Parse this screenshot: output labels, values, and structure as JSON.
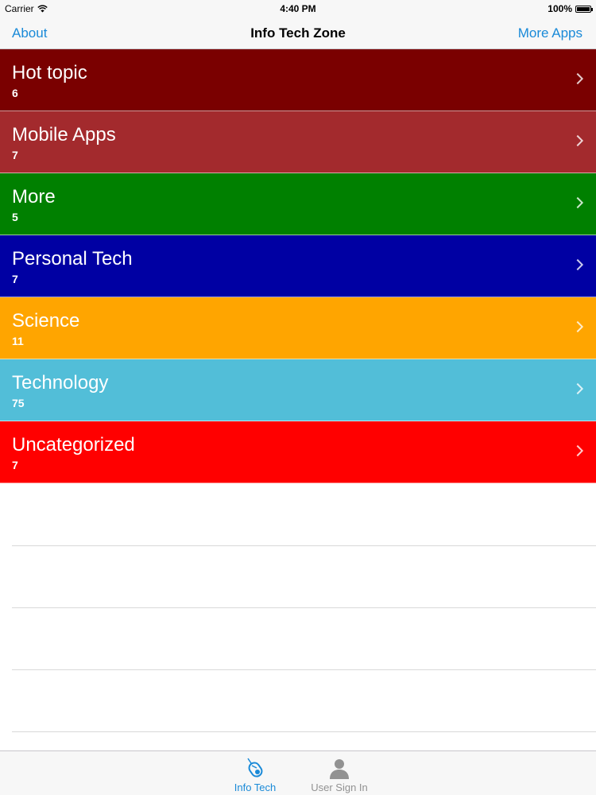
{
  "status": {
    "carrier": "Carrier",
    "time": "4:40 PM",
    "battery": "100%"
  },
  "nav": {
    "left": "About",
    "title": "Info Tech Zone",
    "right": "More Apps"
  },
  "categories": [
    {
      "title": "Hot topic",
      "count": "6",
      "color": "#7a0000"
    },
    {
      "title": "Mobile Apps",
      "count": "7",
      "color": "#a32a2d"
    },
    {
      "title": "More",
      "count": "5",
      "color": "#008000"
    },
    {
      "title": "Personal Tech",
      "count": "7",
      "color": "#0000a3"
    },
    {
      "title": "Science",
      "count": "11",
      "color": "#ffa500"
    },
    {
      "title": "Technology",
      "count": "75",
      "color": "#52bed8"
    },
    {
      "title": "Uncategorized",
      "count": "7",
      "color": "#ff0000"
    }
  ],
  "tabs": [
    {
      "label": "Info Tech",
      "icon": "mouse-icon",
      "active": true
    },
    {
      "label": "User Sign In",
      "icon": "user-icon",
      "active": false
    }
  ],
  "colors": {
    "accent": "#1a8ad8",
    "inactive": "#929292"
  }
}
